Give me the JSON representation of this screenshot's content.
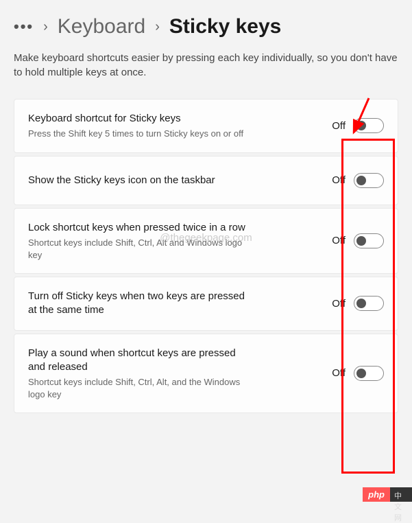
{
  "breadcrumb": {
    "dots": "•••",
    "link": "Keyboard",
    "current": "Sticky keys"
  },
  "description": "Make keyboard shortcuts easier by pressing each key individually, so you don't have to hold multiple keys at once.",
  "settings": [
    {
      "title": "Keyboard shortcut for Sticky keys",
      "sub": "Press the Shift key 5 times to turn Sticky keys on or off",
      "state": "Off"
    },
    {
      "title": "Show the Sticky keys icon on the taskbar",
      "sub": "",
      "state": "Off"
    },
    {
      "title": "Lock shortcut keys when pressed twice in a row",
      "sub": "Shortcut keys include Shift, Ctrl, Alt and Windows logo key",
      "state": "Off"
    },
    {
      "title": "Turn off Sticky keys when two keys are pressed at the same time",
      "sub": "",
      "state": "Off"
    },
    {
      "title": "Play a sound when shortcut keys are pressed and released",
      "sub": "Shortcut keys include Shift, Ctrl, Alt, and the Windows logo key",
      "state": "Off"
    }
  ],
  "watermark": "@thegeekpage.com",
  "annotation": {
    "arrow_color": "#ff0000",
    "highlight_color": "#ff0000"
  },
  "badge": {
    "php": "php",
    "cn": "中文网"
  }
}
